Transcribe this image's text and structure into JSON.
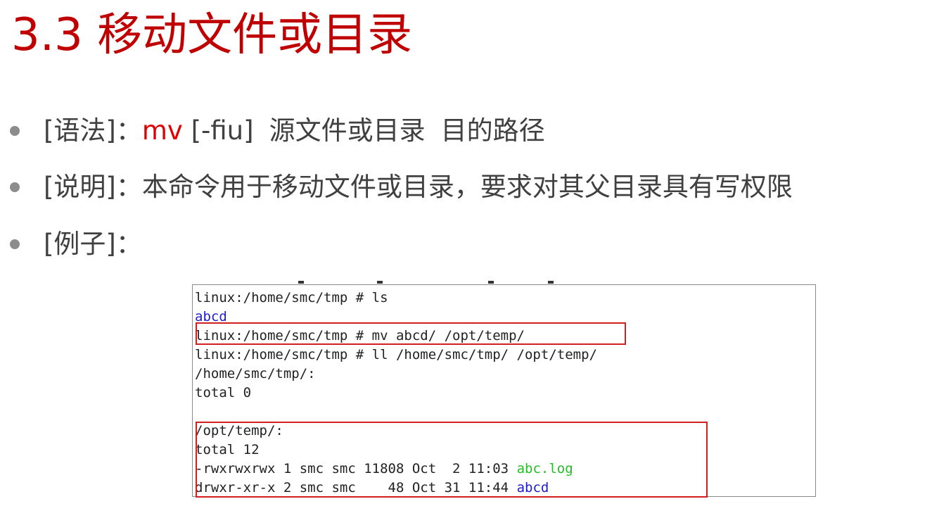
{
  "slide": {
    "title": "3.3 移动文件或目录"
  },
  "bullets": [
    {
      "label": "[语法]：",
      "command": "mv",
      "rest": "[-fiu]",
      "arg1": "源文件或目录",
      "arg2": "目的路径"
    },
    {
      "label": "[说明]：",
      "text": "本命令用于移动文件或目录，要求对其父目录具有写权限"
    },
    {
      "label": "[例子]："
    }
  ],
  "terminal": {
    "lines": [
      "linux:/home/smc/tmp # ls",
      "abcd",
      "linux:/home/smc/tmp # mv abcd/ /opt/temp/",
      "linux:/home/smc/tmp # ll /home/smc/tmp/ /opt/temp/",
      "/home/smc/tmp/:",
      "total 0",
      "",
      "/opt/temp/:",
      "total 12"
    ],
    "file_rows": [
      {
        "meta": "-rwxrwxrwx 1 smc smc 11808 Oct  2 11:03 ",
        "name": "abc.log"
      },
      {
        "meta": "drwxr-xr-x 2 smc smc    48 Oct 31 11:44 ",
        "name": "abcd"
      }
    ],
    "colors": {
      "directory": "#1d1dcf",
      "file": "#22c022",
      "highlight": "#d21f1f"
    }
  }
}
